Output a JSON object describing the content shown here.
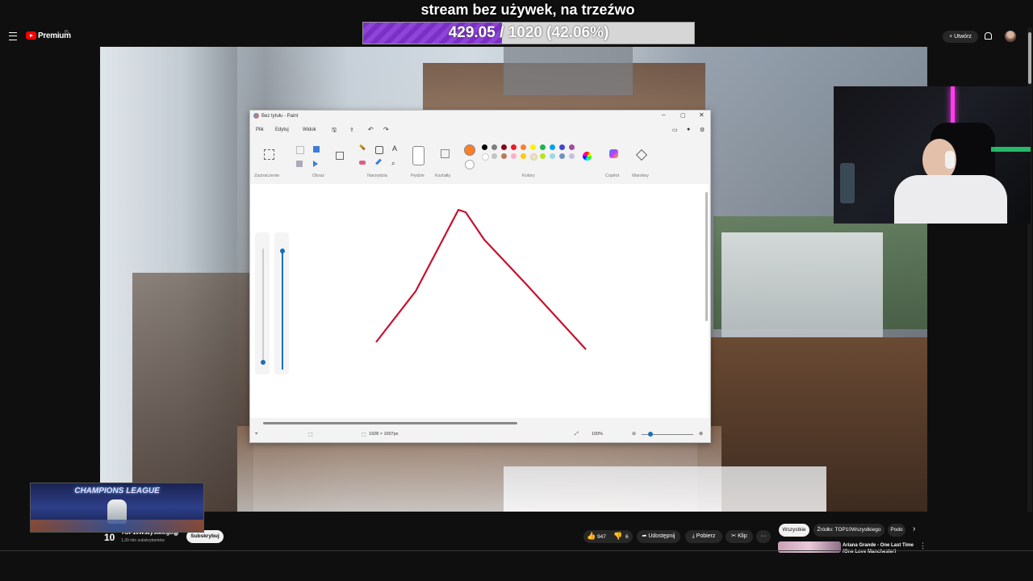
{
  "overlay": {
    "title": "stream bez używek, na trzeźwo",
    "progress_text": "429.05 / 1020 (42.06%)",
    "progress_fraction": 0.4206,
    "fill_color": "#7a2fc6"
  },
  "header": {
    "logo_text": "Premium",
    "country_code": "PL",
    "create_label": "Utwórz"
  },
  "paint": {
    "window_title": "Bez tytułu - Paint",
    "menu": [
      "Plik",
      "Edytuj",
      "Widok"
    ],
    "sections": {
      "selection": "Zaznaczenie",
      "image": "Obraz",
      "tools": "Narzędzia",
      "brushes": "Pędzle",
      "shapes": "Kształty",
      "colors": "Kolory",
      "copilot": "Copilot",
      "layers": "Warstwy"
    },
    "palette_row1": [
      "#000000",
      "#7f7f7f",
      "#880015",
      "#ed1c24",
      "#ff7f27",
      "#fff200",
      "#22b14c",
      "#00a2e8",
      "#3f48cc",
      "#a349a4"
    ],
    "palette_row2": [
      "#ffffff",
      "#c3c3c3",
      "#b97a57",
      "#ffaec9",
      "#ffc90e",
      "#efe4b0",
      "#b5e61d",
      "#99d9ea",
      "#7092be",
      "#c8bfe7"
    ],
    "primary_color": "#ff7f27",
    "stroke_color": "#c8102e",
    "canvas_size": "1928 × 1007px",
    "zoom": "100%"
  },
  "channel": {
    "name": "TOP10Wszystkiego",
    "subscribers": "1,39 mln subskrybentów",
    "subscribe_label": "Subskrybuj",
    "logo_number": "10"
  },
  "actions": {
    "likes": "947",
    "dislikes": "6",
    "share": "Udostępnij",
    "download": "Pobierz",
    "clip": "Klip"
  },
  "chips": [
    "Wszystkie",
    "Źródło: TOP10Wszystkiego",
    "Podo"
  ],
  "recommendation": {
    "title": "Ariana Grande - One Last Time (One Love Manchester)"
  },
  "overlay_thumb": {
    "title": "CHAMPIONS LEAGUE"
  }
}
